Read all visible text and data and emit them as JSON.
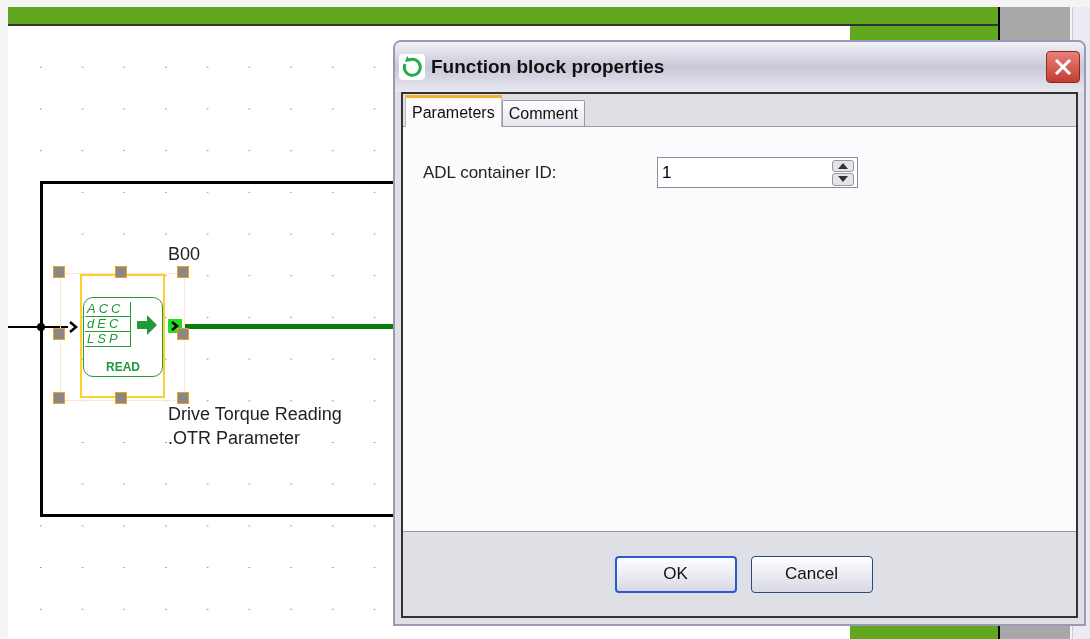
{
  "diagram": {
    "block": {
      "name": "B00",
      "selected": true,
      "icon_lines": [
        "ACC",
        "dEC",
        "LSP"
      ],
      "icon_caption": "READ",
      "description": [
        "Drive Torque Reading",
        ".OTR Parameter"
      ]
    }
  },
  "dialog": {
    "title": "Function block properties",
    "tabs": [
      {
        "label": "Parameters",
        "selected": true
      },
      {
        "label": "Comment",
        "selected": false
      }
    ],
    "fields": [
      {
        "label": "ADL container ID:",
        "value": "1"
      }
    ],
    "buttons": [
      {
        "label": "OK",
        "default": true
      },
      {
        "label": "Cancel",
        "default": false
      }
    ]
  }
}
